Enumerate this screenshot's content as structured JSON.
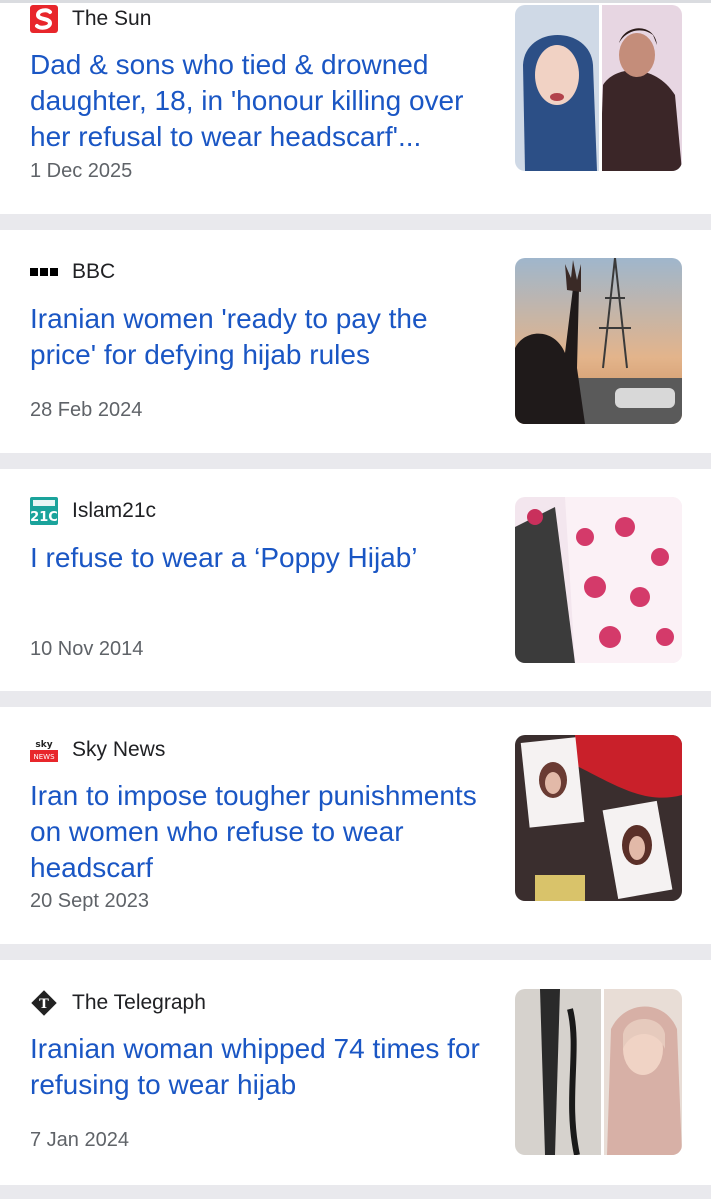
{
  "articles": [
    {
      "source": "The Sun",
      "logo_icon": "the-sun-logo-icon",
      "logo_color": "#e8262b",
      "headline": "Dad & sons who tied & drowned daughter, 18, in 'honour killing over her refusal to wear headscarf'...",
      "date": "1 Dec 2025"
    },
    {
      "source": "BBC",
      "logo_icon": "bbc-logo-icon",
      "logo_color": "#000000",
      "headline": "Iranian women 'ready to pay the price' for defying hijab rules",
      "date": "28 Feb 2024"
    },
    {
      "source": "Islam21c",
      "logo_icon": "islam21c-logo-icon",
      "logo_color": "#1aa39b",
      "headline": "I refuse to wear a ‘Poppy Hijab’",
      "date": "10 Nov 2014"
    },
    {
      "source": "Sky News",
      "logo_icon": "sky-news-logo-icon",
      "logo_color": "#e8262b",
      "headline": "Iran to impose tougher punishments on women who refuse to wear headscarf",
      "date": "20 Sept 2023"
    },
    {
      "source": "The Telegraph",
      "logo_icon": "telegraph-logo-icon",
      "logo_color": "#222222",
      "headline": "Iranian woman whipped 74 times for refusing to wear hijab",
      "date": "7 Jan 2024"
    }
  ],
  "colors": {
    "headline": "#1a56c4",
    "date": "#5f6368",
    "separator": "#e9e9ed"
  }
}
